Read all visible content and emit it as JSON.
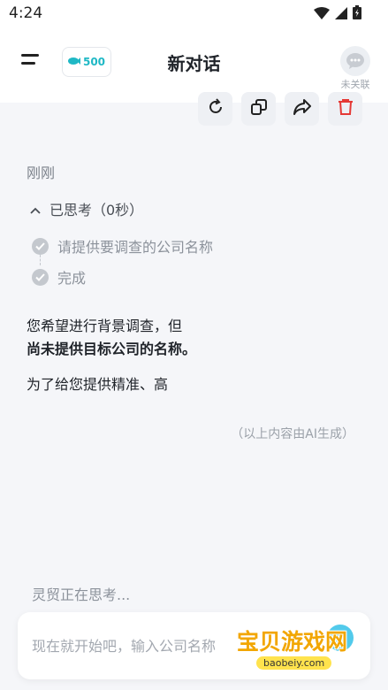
{
  "status_bar": {
    "time": "4:24"
  },
  "header": {
    "title": "新对话",
    "coins": "500",
    "wechat_label": "未关联"
  },
  "chat": {
    "timestamp": "刚刚",
    "thinking_label": "已思考（0秒）",
    "steps": [
      {
        "label": "请提供要调查的公司名称"
      },
      {
        "label": "完成"
      }
    ],
    "answer": {
      "line1": "您希望进行背景调查，但",
      "line2": "尚未提供目标公司的名称。",
      "line3": "为了给您提供精准、高"
    },
    "ai_note": "（以上内容由AI生成）",
    "typing_status": "灵贸正在思考..."
  },
  "composer": {
    "placeholder": "现在就开始吧，输入公司名称"
  },
  "watermark": {
    "title": "宝贝游戏网",
    "url": "baobeiy.com"
  },
  "colors": {
    "accent": "#1fb8c5",
    "delete": "#e53935",
    "background": "#f5f6f9"
  }
}
